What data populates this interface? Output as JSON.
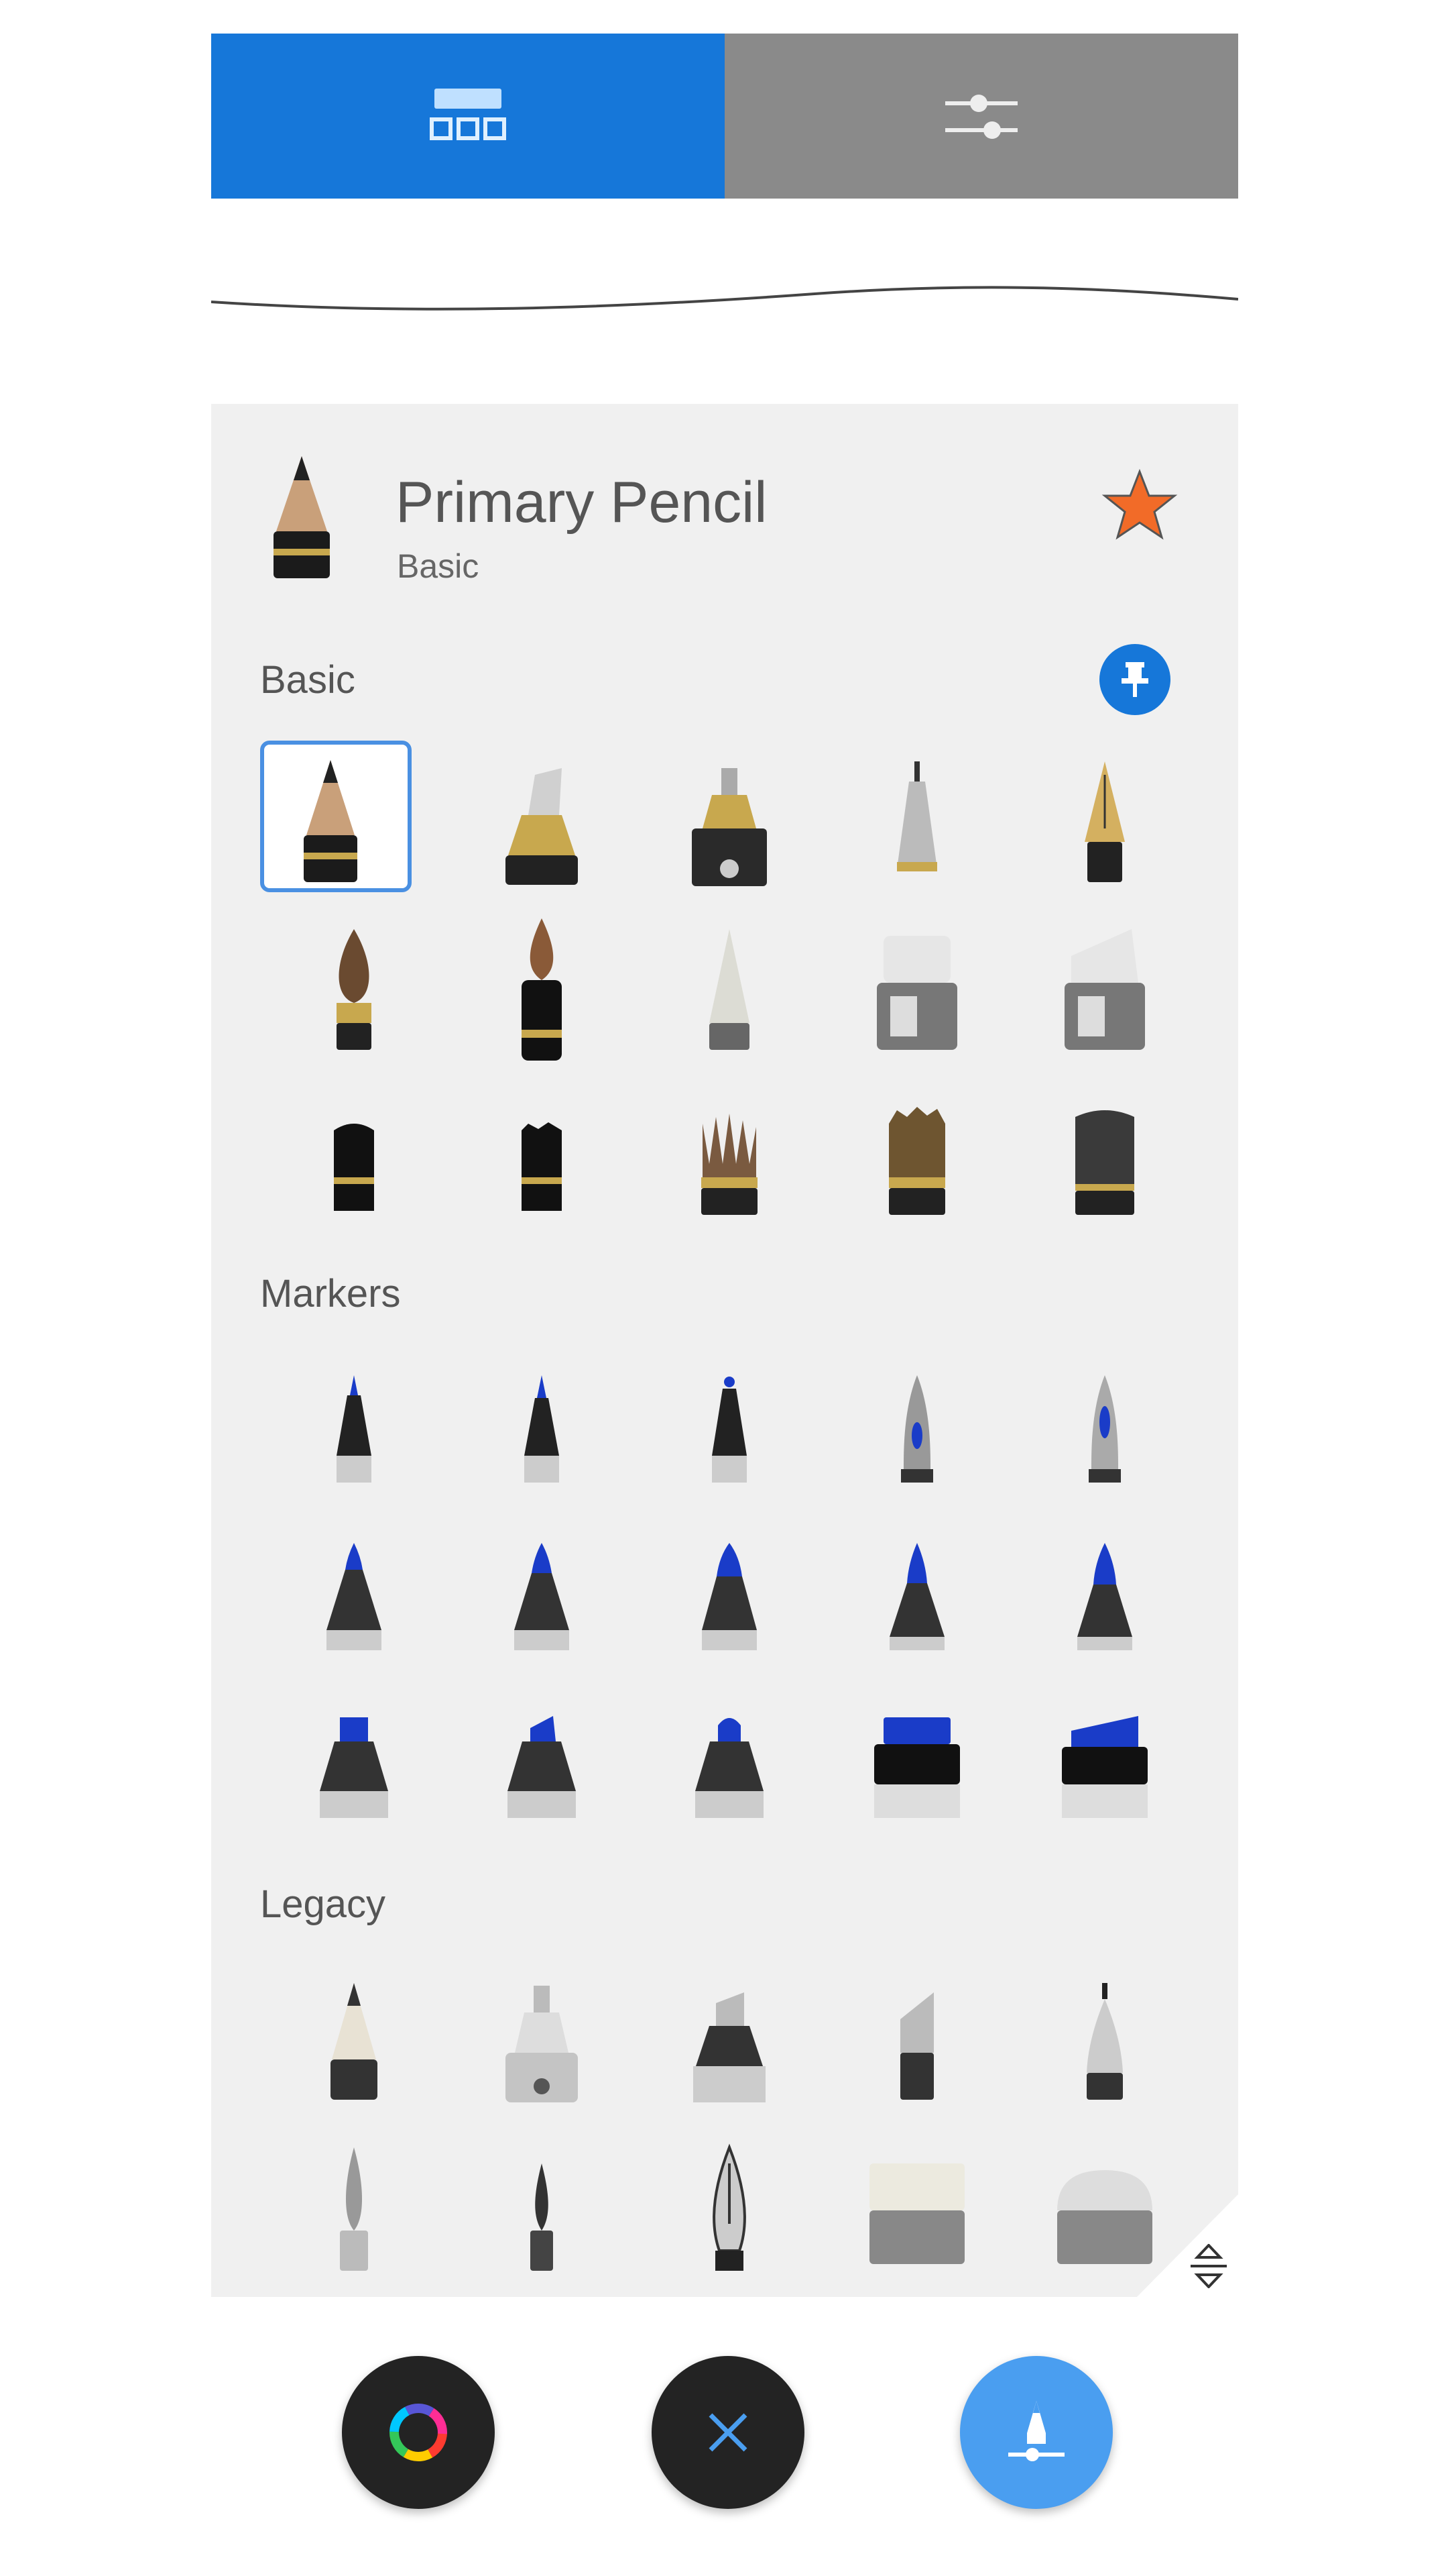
{
  "tabs": [
    {
      "name": "brush-library-icon",
      "active": true
    },
    {
      "name": "brush-settings-icon",
      "active": false
    }
  ],
  "current_brush": {
    "name": "Primary Pencil",
    "category": "Basic"
  },
  "sections": {
    "basic": "Basic",
    "markers": "Markers",
    "legacy": "Legacy"
  },
  "colors": {
    "accent": "#1677d9",
    "star": "#f26b28",
    "panel": "#f0f0f0"
  },
  "bottom_bar": [
    "color-wheel-icon",
    "close-icon",
    "brush-tool-icon"
  ]
}
